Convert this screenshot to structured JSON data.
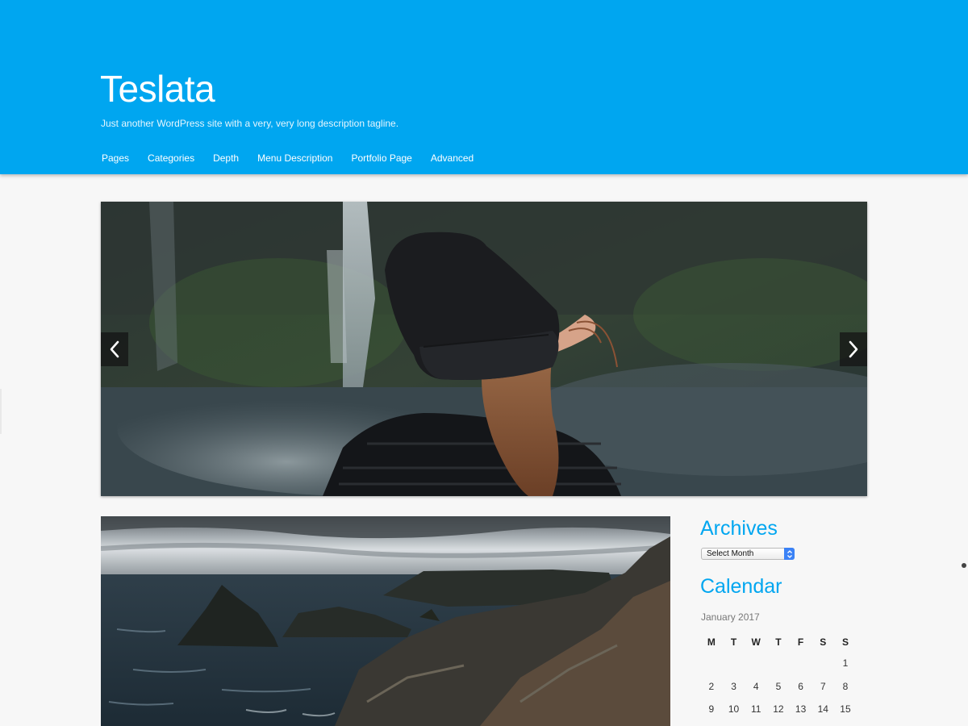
{
  "site": {
    "title": "Teslata",
    "tagline": "Just another WordPress site with a very, very long description tagline."
  },
  "nav": {
    "items": [
      {
        "label": "Pages"
      },
      {
        "label": "Categories"
      },
      {
        "label": "Depth"
      },
      {
        "label": "Menu Description"
      },
      {
        "label": "Portfolio Page"
      },
      {
        "label": "Advanced"
      }
    ]
  },
  "slider": {
    "prev_icon": "chevron-left-icon",
    "next_icon": "chevron-right-icon"
  },
  "sidebar": {
    "archives": {
      "title": "Archives",
      "select_value": "Select Month"
    },
    "calendar": {
      "title": "Calendar",
      "caption": "January 2017",
      "weekdays": [
        "M",
        "T",
        "W",
        "T",
        "F",
        "S",
        "S"
      ],
      "weeks": [
        [
          "",
          "",
          "",
          "",
          "",
          "",
          "1"
        ],
        [
          "2",
          "3",
          "4",
          "5",
          "6",
          "7",
          "8"
        ],
        [
          "9",
          "10",
          "11",
          "12",
          "13",
          "14",
          "15"
        ]
      ]
    }
  },
  "colors": {
    "accent": "#00a6f0",
    "page_background": "#f7f7f7"
  }
}
